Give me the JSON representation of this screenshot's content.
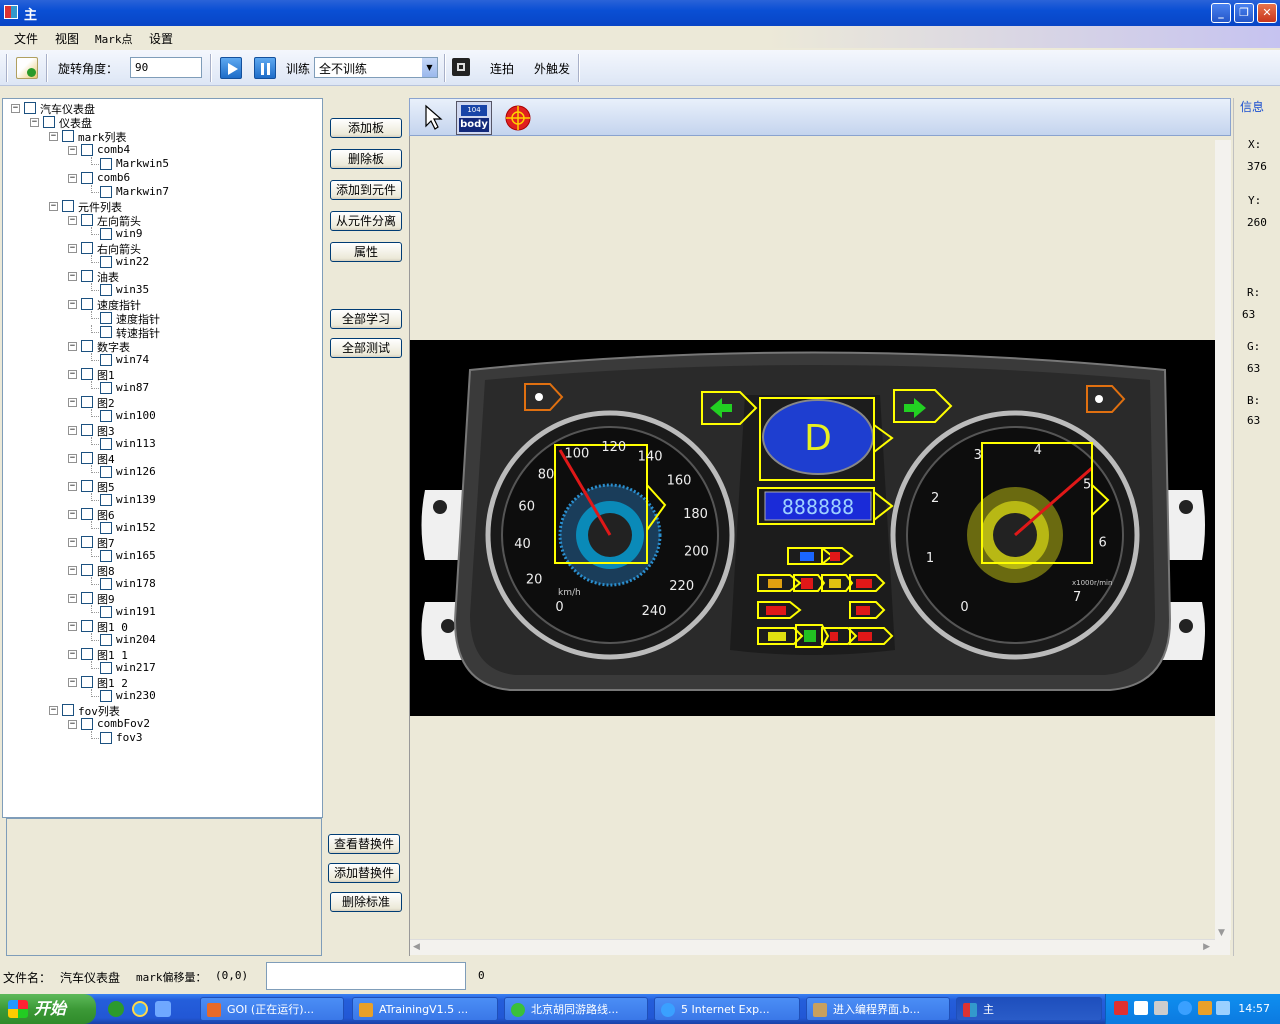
{
  "window": {
    "title": "主"
  },
  "menu": [
    "文件",
    "视图",
    "Mark点",
    "设置"
  ],
  "toolbar": {
    "rotate_label": "旋转角度：",
    "rotate_value": "90",
    "train_label": "训练",
    "train_select": "全不训练",
    "burst_label": "连拍",
    "trigger_label": "外触发"
  },
  "tree": [
    {
      "label": "汽车仪表盘",
      "level": 0,
      "exp": "-"
    },
    {
      "label": "仪表盘",
      "level": 1,
      "exp": "-"
    },
    {
      "label": "mark列表",
      "level": 2,
      "exp": "-"
    },
    {
      "label": "comb4",
      "level": 3,
      "exp": "-"
    },
    {
      "label": "Markwin5",
      "level": 4,
      "exp": ""
    },
    {
      "label": "comb6",
      "level": 3,
      "exp": "-"
    },
    {
      "label": "Markwin7",
      "level": 4,
      "exp": ""
    },
    {
      "label": "元件列表",
      "level": 2,
      "exp": "-"
    },
    {
      "label": "左向箭头",
      "level": 3,
      "exp": "-"
    },
    {
      "label": "win9",
      "level": 4,
      "exp": ""
    },
    {
      "label": "右向箭头",
      "level": 3,
      "exp": "-"
    },
    {
      "label": "win22",
      "level": 4,
      "exp": ""
    },
    {
      "label": "油表",
      "level": 3,
      "exp": "-"
    },
    {
      "label": "win35",
      "level": 4,
      "exp": ""
    },
    {
      "label": "速度指针",
      "level": 3,
      "exp": "-"
    },
    {
      "label": "速度指针",
      "level": 4,
      "exp": ""
    },
    {
      "label": "转速指针",
      "level": 4,
      "exp": ""
    },
    {
      "label": "数字表",
      "level": 3,
      "exp": "-"
    },
    {
      "label": "win74",
      "level": 4,
      "exp": ""
    },
    {
      "label": "图1",
      "level": 3,
      "exp": "-"
    },
    {
      "label": "win87",
      "level": 4,
      "exp": ""
    },
    {
      "label": "图2",
      "level": 3,
      "exp": "-"
    },
    {
      "label": "win100",
      "level": 4,
      "exp": ""
    },
    {
      "label": "图3",
      "level": 3,
      "exp": "-"
    },
    {
      "label": "win113",
      "level": 4,
      "exp": ""
    },
    {
      "label": "图4",
      "level": 3,
      "exp": "-"
    },
    {
      "label": "win126",
      "level": 4,
      "exp": ""
    },
    {
      "label": "图5",
      "level": 3,
      "exp": "-"
    },
    {
      "label": "win139",
      "level": 4,
      "exp": ""
    },
    {
      "label": "图6",
      "level": 3,
      "exp": "-"
    },
    {
      "label": "win152",
      "level": 4,
      "exp": ""
    },
    {
      "label": "图7",
      "level": 3,
      "exp": "-"
    },
    {
      "label": "win165",
      "level": 4,
      "exp": ""
    },
    {
      "label": "图8",
      "level": 3,
      "exp": "-"
    },
    {
      "label": "win178",
      "level": 4,
      "exp": ""
    },
    {
      "label": "图9",
      "level": 3,
      "exp": "-"
    },
    {
      "label": "win191",
      "level": 4,
      "exp": ""
    },
    {
      "label": "图1 0",
      "level": 3,
      "exp": "-"
    },
    {
      "label": "win204",
      "level": 4,
      "exp": ""
    },
    {
      "label": "图1 1",
      "level": 3,
      "exp": "-"
    },
    {
      "label": "win217",
      "level": 4,
      "exp": ""
    },
    {
      "label": "图1 2",
      "level": 3,
      "exp": "-"
    },
    {
      "label": "win230",
      "level": 4,
      "exp": ""
    },
    {
      "label": "fov列表",
      "level": 2,
      "exp": "-"
    },
    {
      "label": "combFov2",
      "level": 3,
      "exp": "-"
    },
    {
      "label": "fov3",
      "level": 4,
      "exp": ""
    }
  ],
  "buttons": {
    "add_board": "添加板",
    "delete_board": "删除板",
    "add_to_component": "添加到元件",
    "detach_component": "从元件分离",
    "properties": "属性",
    "learn_all": "全部学习",
    "test_all": "全部测试",
    "view_replacement": "查看替换件",
    "add_replacement": "添加替换件",
    "delete_standard": "删除标准"
  },
  "view_tools": {
    "body_label": "body",
    "body_top": "104"
  },
  "dashboard": {
    "speed_ticks": [
      "0",
      "20",
      "40",
      "60",
      "80",
      "100",
      "120",
      "140",
      "160",
      "180",
      "200",
      "220",
      "240"
    ],
    "speed_unit": "km/h",
    "rpm_ticks": [
      "0",
      "1",
      "2",
      "3",
      "4",
      "5",
      "6",
      "7"
    ],
    "rpm_unit": "x1000r/min",
    "gear": "D",
    "odometer": "888888"
  },
  "info": {
    "title": "信息",
    "x_label": "X:",
    "x_value": "376",
    "y_label": "Y:",
    "y_value": "260",
    "r_label": "R:",
    "r_value": "63",
    "g_label": "G:",
    "g_value": "63",
    "b_label": "B:",
    "b_value": "63"
  },
  "status": {
    "file_label": "文件名：",
    "file_value": "汽车仪表盘",
    "mark_offset_label": "mark偏移量：",
    "mark_offset_value": "(0,0)",
    "count": "0"
  },
  "taskbar": {
    "start": "开始",
    "tasks": [
      "GOI (正在运行)...",
      "ATrainingV1.5 ...",
      "北京胡同游路线...",
      "5 Internet Exp...",
      "进入编程界面.b...",
      "主"
    ],
    "clock": "14:57"
  },
  "colors": {
    "accent": "#0a4fd4",
    "mark_box": "#ffff00",
    "taskbar": "#245edb"
  }
}
